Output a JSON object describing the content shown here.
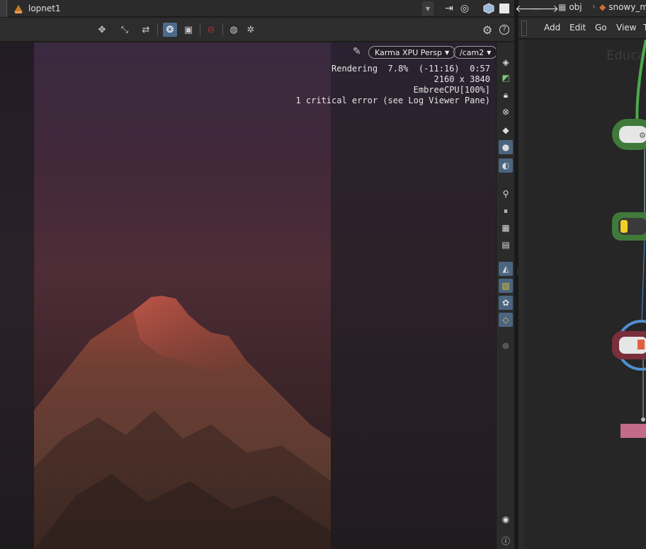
{
  "left_pane": {
    "path_node": "lopnet1",
    "renderer": "Karma XPU  Persp",
    "camera": "/cam2",
    "hud": {
      "line1": "Rendering  7.8%  (-11:16)  0:57",
      "line2": "2160 x 3840",
      "line3": "EmbreeCPU[100%]",
      "line4": "1 critical error (see Log Viewer Pane)"
    }
  },
  "right_pane": {
    "path": [
      "obj",
      "snowy_m"
    ],
    "menu": [
      "Add",
      "Edit",
      "Go",
      "View",
      "T"
    ],
    "watermark": "Educa"
  },
  "colors": {
    "accent_active": "#4d6a8a",
    "node_green": "#3f7a3a",
    "node_red": "#7a2f3b",
    "node_pink": "#c56b8a",
    "wire_blue": "#4f8fcf"
  }
}
